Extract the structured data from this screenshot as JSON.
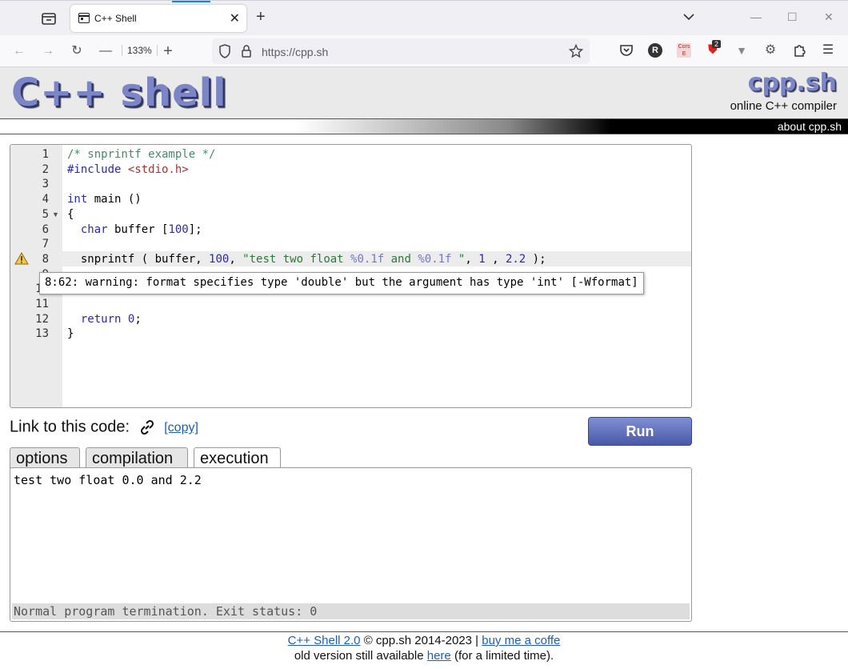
{
  "browser": {
    "tab_title": "C++ Shell",
    "zoom": "133%",
    "url": "https://cpp.sh",
    "ext_badge": "2",
    "ext_cors": "Cors E",
    "ext_r": "R"
  },
  "header": {
    "logo": "C++ shell",
    "brand": "cpp.sh",
    "subtitle": "online C++ compiler",
    "about_link": "about cpp.sh"
  },
  "editor": {
    "lines": [
      {
        "n": "1",
        "parts": [
          {
            "t": "/* snprintf example */",
            "c": "c-cm"
          }
        ]
      },
      {
        "n": "2",
        "parts": [
          {
            "t": "#include ",
            "c": "c-pp"
          },
          {
            "t": "<stdio.h>",
            "c": "c-inc"
          }
        ]
      },
      {
        "n": "3",
        "parts": []
      },
      {
        "n": "4",
        "parts": [
          {
            "t": "int",
            "c": "c-kw"
          },
          {
            "t": " main ()",
            "c": ""
          }
        ]
      },
      {
        "n": "5",
        "parts": [
          {
            "t": "{",
            "c": ""
          }
        ]
      },
      {
        "n": "6",
        "parts": [
          {
            "t": "  ",
            "c": ""
          },
          {
            "t": "char",
            "c": "c-kw"
          },
          {
            "t": " buffer [",
            "c": ""
          },
          {
            "t": "100",
            "c": "c-num"
          },
          {
            "t": "];",
            "c": ""
          }
        ]
      },
      {
        "n": "7",
        "parts": []
      },
      {
        "n": "8",
        "parts": [
          {
            "t": "  snprintf ( buffer, ",
            "c": ""
          },
          {
            "t": "100",
            "c": "c-num"
          },
          {
            "t": ", ",
            "c": ""
          },
          {
            "t": "\"test two float ",
            "c": "c-str"
          },
          {
            "t": "%0.1f",
            "c": "c-fmt"
          },
          {
            "t": " and ",
            "c": "c-str"
          },
          {
            "t": "%0.1f",
            "c": "c-fmt"
          },
          {
            "t": " \"",
            "c": "c-str"
          },
          {
            "t": ", ",
            "c": ""
          },
          {
            "t": "1",
            "c": "c-num"
          },
          {
            "t": " , ",
            "c": ""
          },
          {
            "t": "2.2",
            "c": "c-num"
          },
          {
            "t": " );",
            "c": ""
          }
        ]
      },
      {
        "n": "9",
        "parts": []
      },
      {
        "n": "10",
        "parts": []
      },
      {
        "n": "11",
        "parts": []
      },
      {
        "n": "12",
        "parts": [
          {
            "t": "  ",
            "c": ""
          },
          {
            "t": "return",
            "c": "c-kw"
          },
          {
            "t": " ",
            "c": ""
          },
          {
            "t": "0",
            "c": "c-num"
          },
          {
            "t": ";",
            "c": ""
          }
        ]
      },
      {
        "n": "13",
        "parts": [
          {
            "t": "}",
            "c": ""
          }
        ]
      }
    ],
    "tooltip": "8:62: warning: format specifies type 'double' but the argument has type 'int' [-Wformat]"
  },
  "link_row": {
    "label": "Link to this code:",
    "copy": "[copy]"
  },
  "run_button": "Run",
  "tabs": [
    "options",
    "compilation",
    "execution"
  ],
  "output": {
    "text": "test two float 0.0 and 2.2",
    "status": "Normal program termination. Exit status: 0"
  },
  "footer": {
    "shell_link": "C++ Shell 2.0",
    "copyright": "© cpp.sh 2014-2023 |",
    "coffee_link": "buy me a coffe",
    "old_text": "old version still available",
    "here_link": "here",
    "limited": "(for a limited time)."
  }
}
